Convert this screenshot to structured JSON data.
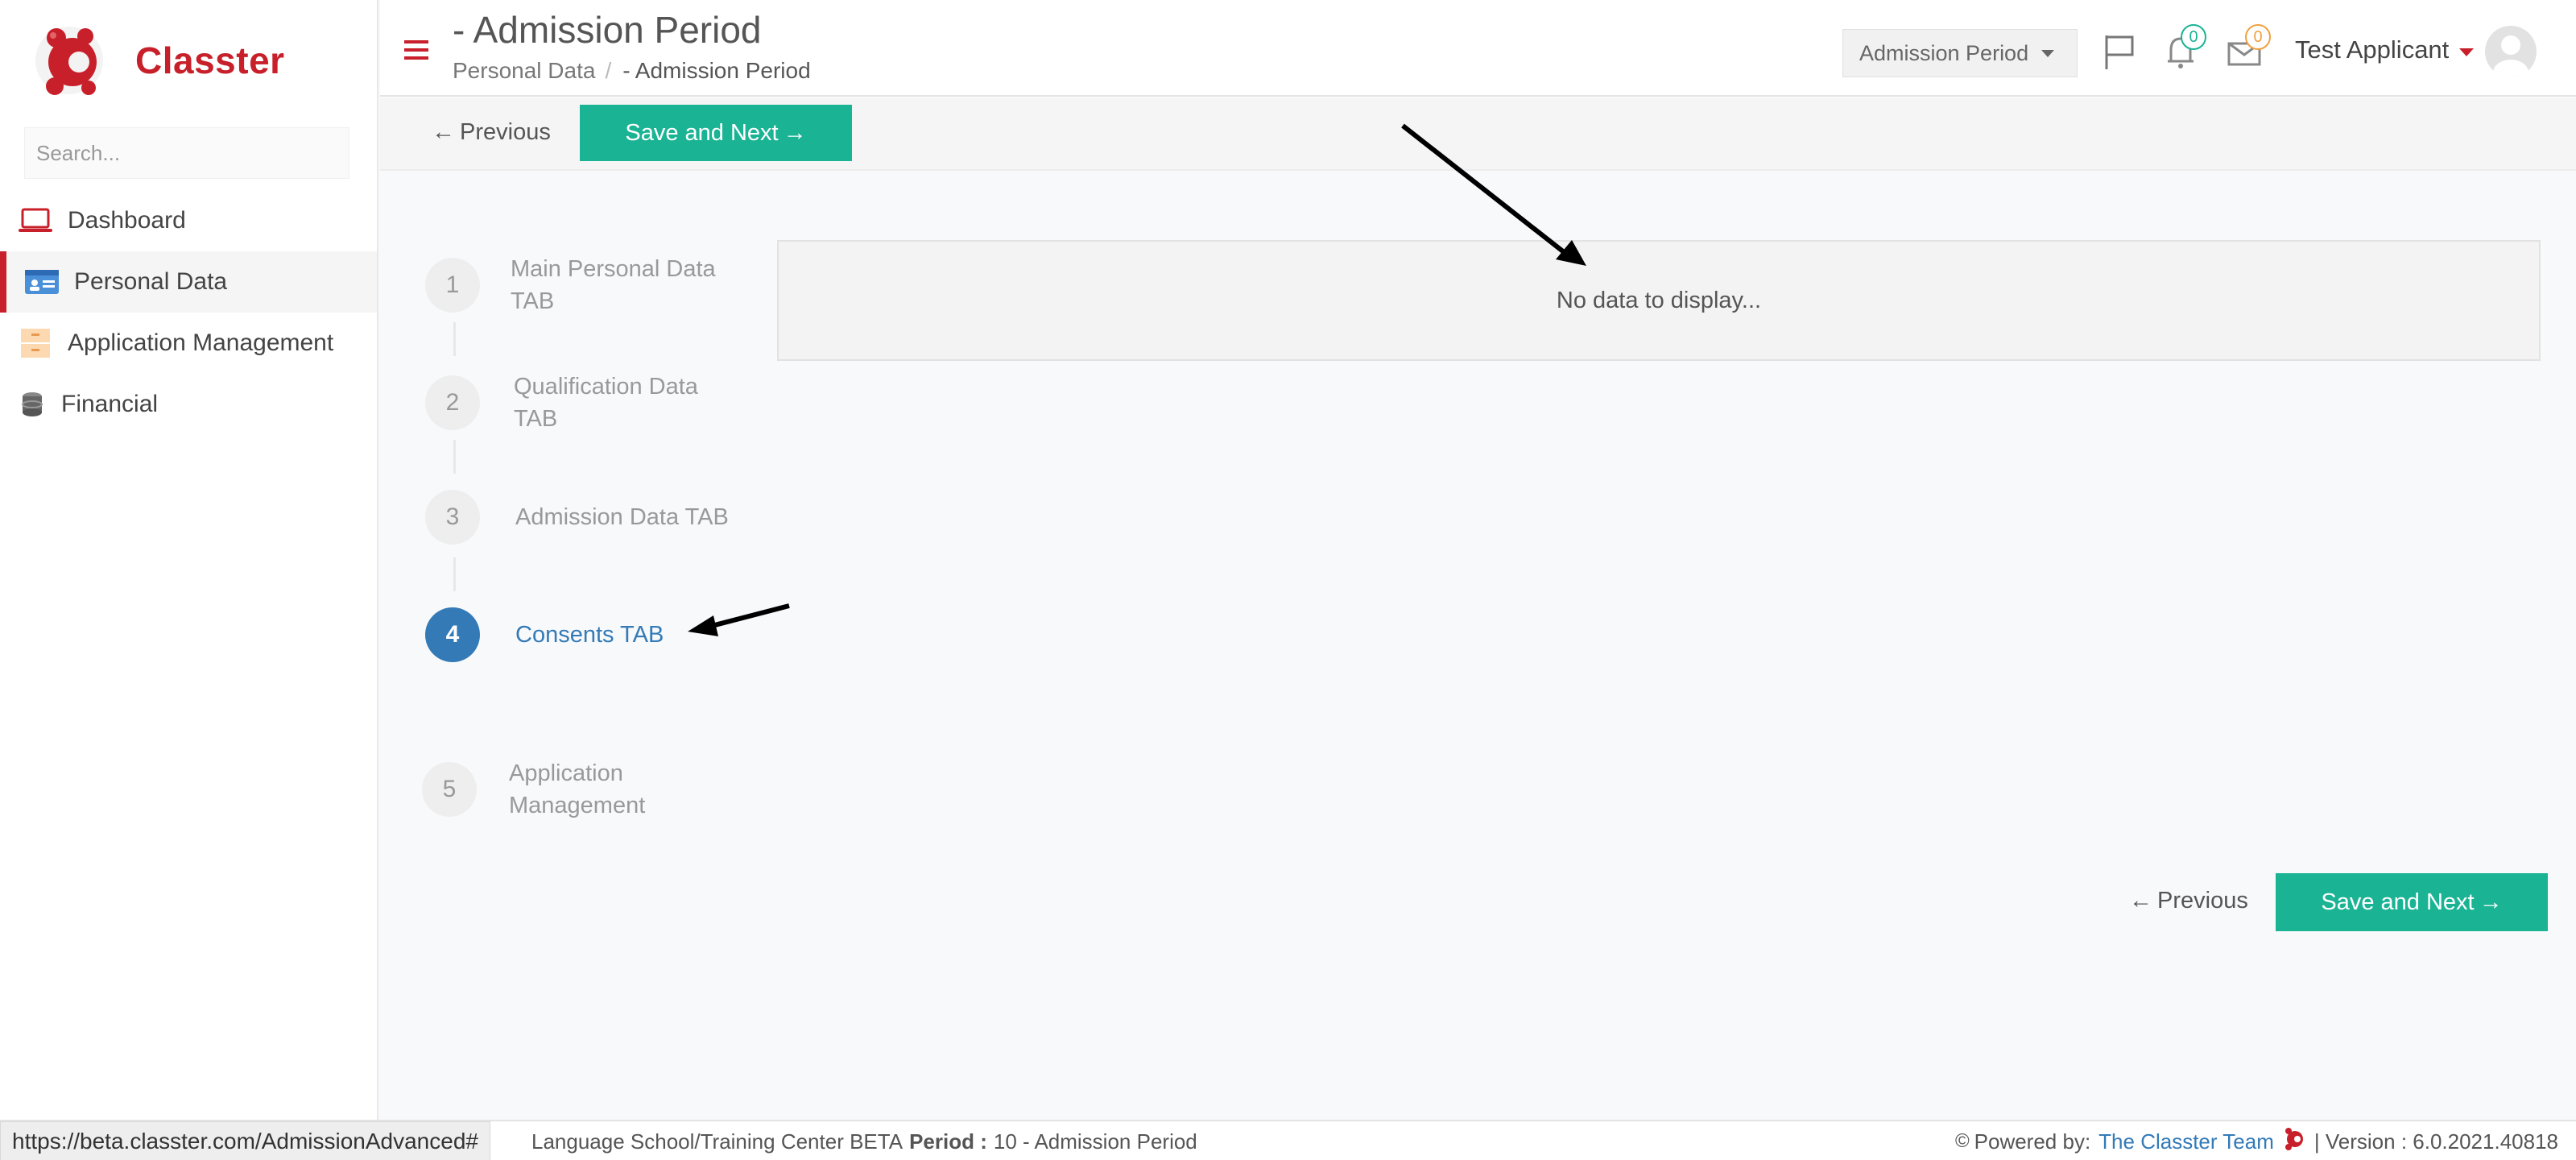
{
  "brand": {
    "name": "Classter",
    "color": "#c8202a"
  },
  "sidebar": {
    "search_placeholder": "Search...",
    "items": [
      {
        "label": "Dashboard",
        "icon": "laptop-icon"
      },
      {
        "label": "Personal Data",
        "icon": "id-card-icon",
        "active": true
      },
      {
        "label": "Application Management",
        "icon": "folder-icon"
      },
      {
        "label": "Financial",
        "icon": "coins-icon"
      }
    ]
  },
  "header": {
    "title": "- Admission Period",
    "breadcrumb": {
      "parent": "Personal Data",
      "separator": "/",
      "current": "- Admission Period"
    },
    "period_select": "Admission Period",
    "notifications_count": "0",
    "messages_count": "0",
    "user_name": "Test Applicant"
  },
  "toolbar": {
    "previous_label": "Previous",
    "save_next_label": "Save and Next",
    "accent_color": "#1ab394"
  },
  "steps": [
    {
      "number": "1",
      "label": "Main Personal Data TAB"
    },
    {
      "number": "2",
      "label": "Qualification Data TAB"
    },
    {
      "number": "3",
      "label": "Admission Data TAB"
    },
    {
      "number": "4",
      "label": "Consents TAB",
      "active": true
    },
    {
      "number": "5",
      "label": "Application Management"
    }
  ],
  "content": {
    "empty_message": "No data to display..."
  },
  "footer": {
    "status_url": "https://beta.classter.com/AdmissionAdvanced#",
    "school": "Language School/Training Center BETA",
    "period_label": "Period :",
    "period_value": "10 - Admission Period",
    "powered_by": "Powered by:",
    "team": "The Classter Team",
    "version": "| Version : 6.0.2021.40818"
  }
}
